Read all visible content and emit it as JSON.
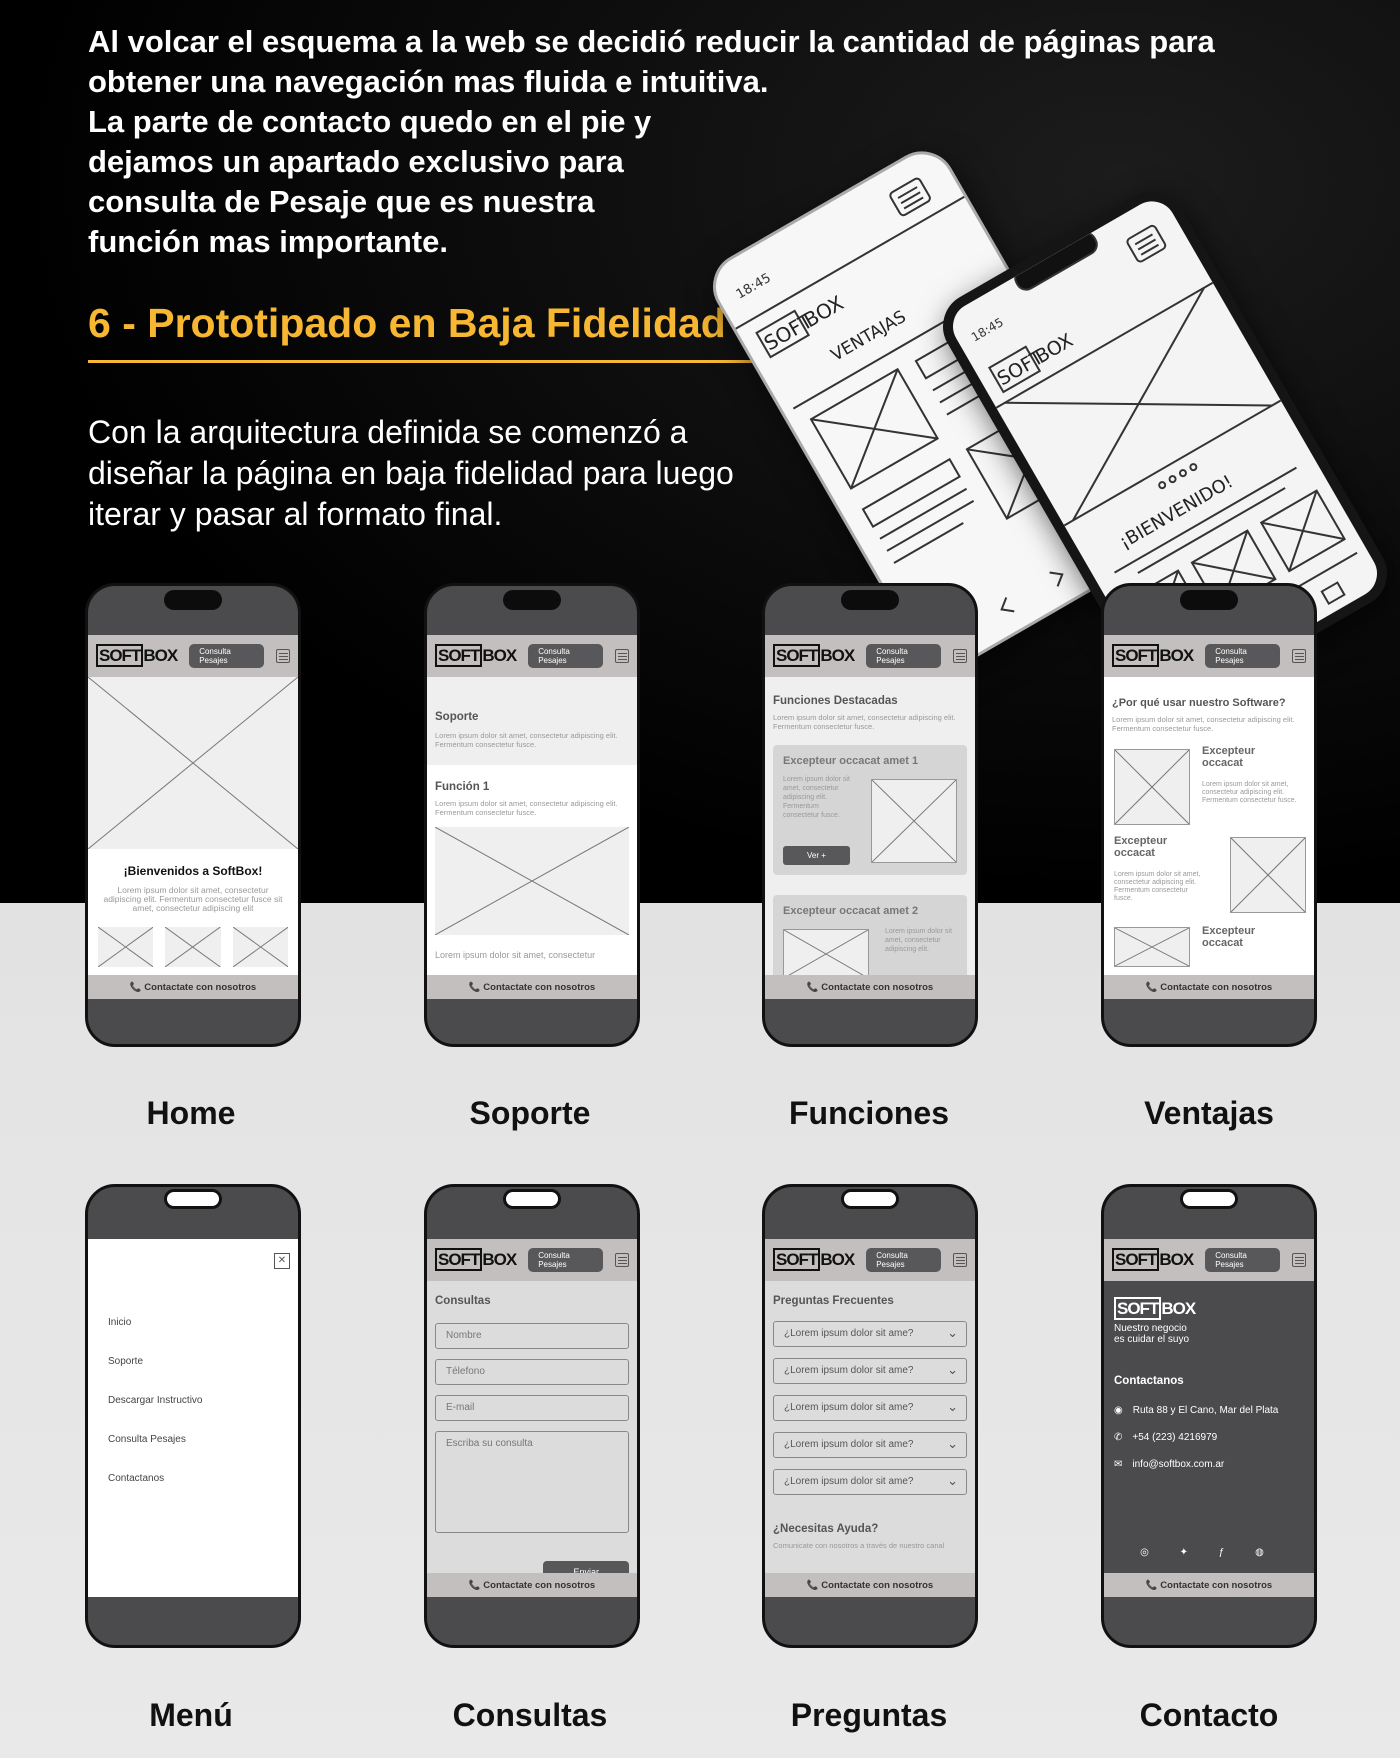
{
  "intro": {
    "line1": "Al volcar el esquema a la web se decidió reducir la cantidad de páginas para",
    "line2": "obtener una navegación mas fluida e intuitiva.",
    "line3": "La parte de contacto quedo en el pie y",
    "line4": "dejamos un apartado exclusivo para",
    "line5": "consulta de Pesaje que es nuestra",
    "line6": "función mas importante."
  },
  "section_title": "6 - Prototipado en Baja Fidelidad",
  "description": {
    "line1": "Con la arquitectura definida se comenzó a",
    "line2": "diseñar la página en baja fidelidad para luego",
    "line3": "iterar y pasar al formato final."
  },
  "sketch": {
    "time": "18:45",
    "logo_soft": "SOFT",
    "logo_box": "BOX",
    "back_title": "VENTAJAS",
    "front_title": "¡BIENVENIDO!"
  },
  "wire": {
    "logo_soft": "SOFT",
    "logo_box": "BOX",
    "cta": "Consulta Pesajes",
    "footer": "📞 Contactate con nosotros",
    "lorem_short": "Lorem ipsum dolor sit amet, consectetur adipiscing elit. Fermentum consectetur fusce.",
    "lorem_center": "Lorem ipsum dolor sit amet, consectetur adipiscing elit. Fermentum consectetur fusce sit amet, consectetur adipiscing elit",
    "lorem_cut": "Lorem ipsum dolor sit amet, consectetur",
    "lorem_card": "Lorem ipsum dolor sit amet, consectetur adipiscing elit. Fermentum consectetur fusce.",
    "lorem_card2": "Lorem ipsum dolor sit amet, consectetur adipiscing elit."
  },
  "home": {
    "welcome": "¡Bienvenidos a SoftBox!",
    "label": "Home"
  },
  "soporte": {
    "title": "Soporte",
    "func": "Función 1",
    "label": "Soporte"
  },
  "funciones": {
    "title": "Funciones Destacadas",
    "card1": "Excepteur occacat amet 1",
    "card2": "Excepteur occacat amet 2",
    "btn": "Ver +",
    "label": "Funciones"
  },
  "ventajas": {
    "title": "¿Por qué usar nuestro Software?",
    "item": "Excepteur occacat",
    "label": "Ventajas"
  },
  "menu": {
    "items": [
      "Inicio",
      "Soporte",
      "Descargar Instructivo",
      "Consulta Pesajes",
      "Contactanos"
    ],
    "close": "✕",
    "label": "Menú"
  },
  "consultas": {
    "title": "Consultas",
    "f1": "Nombre",
    "f2": "Télefono",
    "f3": "E-mail",
    "f4": "Escriba su consulta",
    "send": "Enviar",
    "label": "Consultas"
  },
  "preguntas": {
    "title": "Preguntas Frecuentes",
    "q": "¿Lorem ipsum dolor sit ame?",
    "help": "¿Necesitas Ayuda?",
    "help_text": "Comunicate con nosotros a través de nuestro canal",
    "label": "Preguntas"
  },
  "contacto": {
    "tagline1": "Nuestro negocio",
    "tagline2": "es cuidar el suyo",
    "heading": "Contactanos",
    "address": "Ruta 88 y El Cano, Mar del Plata",
    "phone": "+54 (223) 4216979",
    "email": "info@softbox.com.ar",
    "label": "Contacto"
  }
}
